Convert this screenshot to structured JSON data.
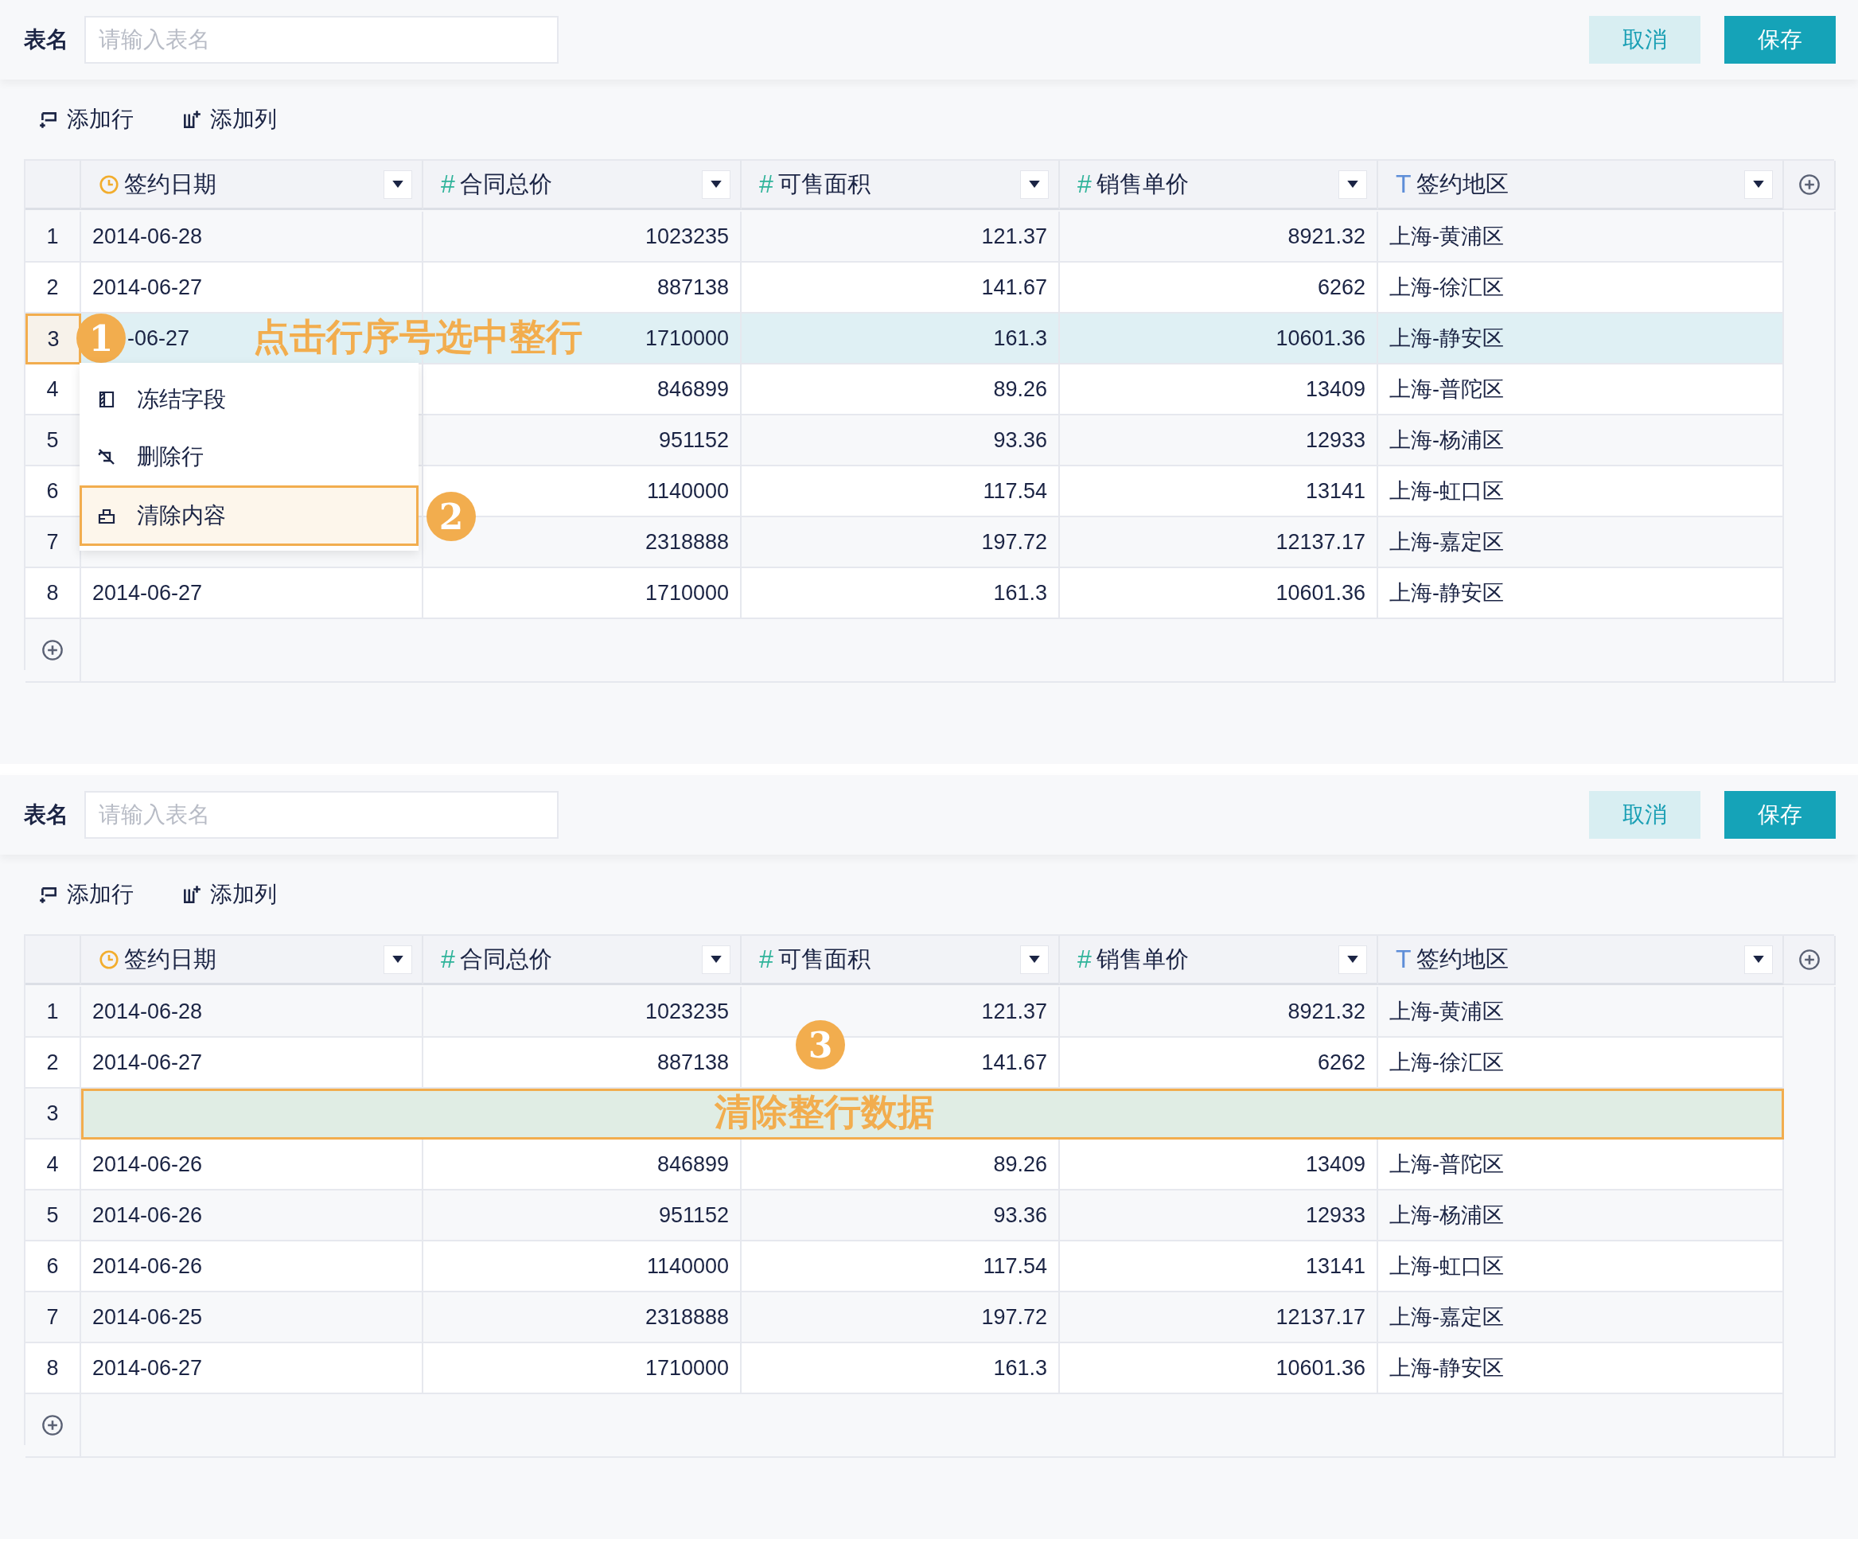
{
  "panels": [
    {
      "name_label": "表名",
      "name_field": {
        "placeholder": "请输入表名"
      },
      "buttons": [
        {
          "label": "取消",
          "kind": "secondary"
        },
        {
          "label": "保存",
          "kind": "primary"
        }
      ],
      "toolbar": [
        {
          "label": "添加行",
          "kind": "add-row"
        },
        {
          "label": "添加列",
          "kind": "add-column"
        }
      ],
      "columns": [
        {
          "kind": "date",
          "label": "签约日期"
        },
        {
          "kind": "number",
          "icon": "#",
          "label": "合同总价"
        },
        {
          "kind": "number",
          "icon": "#",
          "label": "可售面积"
        },
        {
          "kind": "number",
          "icon": "#",
          "label": "销售单价"
        },
        {
          "kind": "text",
          "icon": "T",
          "label": "签约地区"
        }
      ],
      "rows": [
        {
          "index": "1",
          "selected": false,
          "kind": "data",
          "cells": [
            "2014-06-28",
            "1023235",
            "121.37",
            "8921.32",
            "上海-黄浦区"
          ]
        },
        {
          "index": "2",
          "selected": false,
          "kind": "data",
          "cells": [
            "2014-06-27",
            "887138",
            "141.67",
            "6262",
            "上海-徐汇区"
          ]
        },
        {
          "index": "3",
          "selected": true,
          "kind": "data",
          "marker": "1",
          "cells": [
            "-06-27",
            "1710000",
            "161.3",
            "10601.36",
            "上海-静安区"
          ]
        },
        {
          "index": "4",
          "selected": false,
          "kind": "data",
          "cells": [
            null,
            "846899",
            "89.26",
            "13409",
            "上海-普陀区"
          ]
        },
        {
          "index": "5",
          "selected": false,
          "kind": "data",
          "cells": [
            null,
            "951152",
            "93.36",
            "12933",
            "上海-杨浦区"
          ]
        },
        {
          "index": "6",
          "selected": false,
          "kind": "data",
          "cells": [
            null,
            "1140000",
            "117.54",
            "13141",
            "上海-虹口区"
          ]
        },
        {
          "index": "7",
          "selected": false,
          "kind": "data",
          "cells": [
            null,
            "2318888",
            "197.72",
            "12137.17",
            "上海-嘉定区"
          ]
        },
        {
          "index": "8",
          "selected": false,
          "kind": "data",
          "cells": [
            "2014-06-27",
            "1710000",
            "161.3",
            "10601.36",
            "上海-静安区"
          ]
        }
      ],
      "context_menu": {
        "items": [
          {
            "label": "冻结字段",
            "kind": "freeze",
            "selected": false
          },
          {
            "label": "删除行",
            "kind": "delete",
            "selected": false
          },
          {
            "label": "清除内容",
            "kind": "clear",
            "selected": true
          }
        ]
      },
      "annotations": [
        {
          "kind": "note",
          "text": "点击行序号选中整行"
        },
        {
          "kind": "marker",
          "text": "2"
        }
      ]
    },
    {
      "name_label": "表名",
      "name_field": {
        "placeholder": "请输入表名"
      },
      "buttons": [
        {
          "label": "取消",
          "kind": "secondary"
        },
        {
          "label": "保存",
          "kind": "primary"
        }
      ],
      "toolbar": [
        {
          "label": "添加行",
          "kind": "add-row"
        },
        {
          "label": "添加列",
          "kind": "add-column"
        }
      ],
      "columns": [
        {
          "kind": "date",
          "label": "签约日期"
        },
        {
          "kind": "number",
          "icon": "#",
          "label": "合同总价"
        },
        {
          "kind": "number",
          "icon": "#",
          "label": "可售面积"
        },
        {
          "kind": "number",
          "icon": "#",
          "label": "销售单价"
        },
        {
          "kind": "text",
          "icon": "T",
          "label": "签约地区"
        }
      ],
      "rows": [
        {
          "index": "1",
          "selected": false,
          "kind": "data",
          "cells": [
            "2014-06-28",
            "1023235",
            "121.37",
            "8921.32",
            "上海-黄浦区"
          ]
        },
        {
          "index": "2",
          "selected": false,
          "kind": "data",
          "cells": [
            "2014-06-27",
            "887138",
            "141.67",
            "6262",
            "上海-徐汇区"
          ]
        },
        {
          "index": "3",
          "selected": false,
          "kind": "cleared"
        },
        {
          "index": "4",
          "selected": false,
          "kind": "data",
          "cells": [
            "2014-06-26",
            "846899",
            "89.26",
            "13409",
            "上海-普陀区"
          ]
        },
        {
          "index": "5",
          "selected": false,
          "kind": "data",
          "cells": [
            "2014-06-26",
            "951152",
            "93.36",
            "12933",
            "上海-杨浦区"
          ]
        },
        {
          "index": "6",
          "selected": false,
          "kind": "data",
          "cells": [
            "2014-06-26",
            "1140000",
            "117.54",
            "13141",
            "上海-虹口区"
          ]
        },
        {
          "index": "7",
          "selected": false,
          "kind": "data",
          "cells": [
            "2014-06-25",
            "2318888",
            "197.72",
            "12137.17",
            "上海-嘉定区"
          ]
        },
        {
          "index": "8",
          "selected": false,
          "kind": "data",
          "cells": [
            "2014-06-27",
            "1710000",
            "161.3",
            "10601.36",
            "上海-静安区"
          ]
        }
      ],
      "annotations": [
        {
          "kind": "marker",
          "text": "3"
        },
        {
          "kind": "note",
          "text": "清除整行数据"
        }
      ]
    }
  ]
}
